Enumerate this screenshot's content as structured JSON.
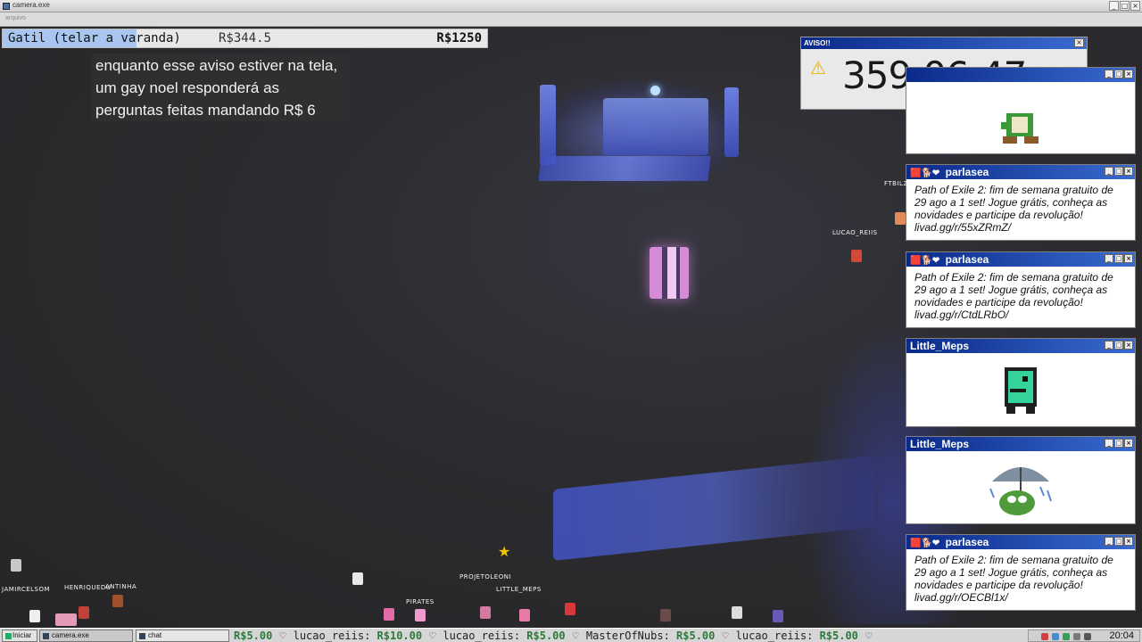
{
  "window": {
    "title": "camera.exe",
    "menu": [
      "arquivo"
    ],
    "controls": [
      "_",
      "□",
      "×"
    ]
  },
  "goal_bar": {
    "label": "Gatil (telar a varanda)",
    "current": "R$344.5",
    "target": "R$1250",
    "progress_fraction": 0.2756
  },
  "warning_text": "enquanto esse aviso estiver na tela, um gay noel responderá as perguntas feitas mandando R$ 6",
  "aviso": {
    "title": "AVISO!!",
    "timer": "359:06:47",
    "close": "×"
  },
  "right_windows": [
    {
      "title": "",
      "kind": "image",
      "image": "green-yoshi-sprite"
    },
    {
      "title": "parlasea",
      "kind": "message",
      "message": "Path of Exile 2: fim de semana gratuito de 29 ago a 1 set! Jogue grátis, conheça as novidades e participe da revolução! livad.gg/r/55xZRmZ/"
    },
    {
      "title": "parlasea",
      "kind": "message",
      "message": "Path of Exile 2: fim de semana gratuito de 29 ago a 1 set! Jogue grátis, conheça as novidades e participe da revolução! livad.gg/r/CtdLRbO/"
    },
    {
      "title": "Little_Meps",
      "kind": "image",
      "image": "green-dino-sprite"
    },
    {
      "title": "Little_Meps",
      "kind": "image",
      "image": "pepe-umbrella-sprite"
    },
    {
      "title": "parlasea",
      "kind": "message",
      "message": "Path of Exile 2: fim de semana gratuito de 29 ago a 1 set! Jogue grátis, conheça as novidades e participe da revolução! livad.gg/r/OECBl1x/"
    }
  ],
  "window_controls": [
    "_",
    "□",
    "×"
  ],
  "viewer_tags": {
    "ftbilz": "FTBILZV",
    "lucao": "LUCAO_REIIS",
    "projetoleoni": "PROJETOLEONI",
    "little_meps": "LITTLE_MEPS",
    "pirates": "PIRATES",
    "jamir": "JAMIRCELSOM",
    "henrique": "HENRIQUEDU",
    "antinha": "ANTINHA"
  },
  "taskbar": {
    "start": "Iniciar",
    "tasks": [
      "camera.exe",
      "chat"
    ],
    "ticker": [
      {
        "amount": "R$5.00"
      },
      {
        "user": "lucao_reiis:",
        "amount": "R$10.00"
      },
      {
        "user": "lucao_reiis:",
        "amount": "R$5.00"
      },
      {
        "user": "MasterOfNubs:",
        "amount": "R$5.00"
      },
      {
        "user": "lucao_reiis:",
        "amount": "R$5.00"
      }
    ],
    "heart": "♡",
    "clock": "20:04"
  },
  "colors": {
    "title_blue_start": "#0a2a8a",
    "title_blue_end": "#3a6ad0",
    "progress_fill": "#a8c6f0",
    "ticker_amount": "#2c7a3a"
  },
  "icons": {
    "warning": "warning-triangle-icon",
    "start": "windows-flag-icon"
  }
}
